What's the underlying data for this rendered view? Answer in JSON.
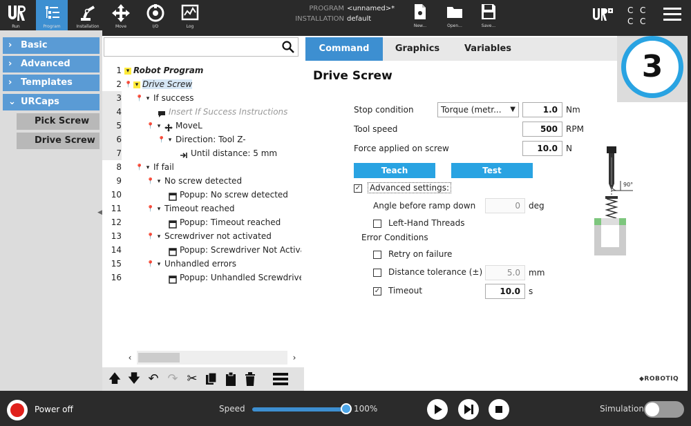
{
  "topbar": {
    "nav": [
      {
        "name": "run",
        "label": "Run"
      },
      {
        "name": "program",
        "label": "Program"
      },
      {
        "name": "installation",
        "label": "Installation"
      },
      {
        "name": "move",
        "label": "Move"
      },
      {
        "name": "io",
        "label": "I/O"
      },
      {
        "name": "log",
        "label": "Log"
      }
    ],
    "program_key": "PROGRAM",
    "program_value": "<unnamed>*",
    "installation_key": "INSTALLATION",
    "installation_value": "default",
    "file_buttons": [
      {
        "name": "new",
        "label": "New..."
      },
      {
        "name": "open",
        "label": "Open..."
      },
      {
        "name": "save",
        "label": "Save..."
      }
    ],
    "urplus_label": "UR+",
    "active_nav": "program"
  },
  "left_panel": {
    "categories": [
      {
        "label": "Basic",
        "chevron": "›"
      },
      {
        "label": "Advanced",
        "chevron": "›"
      },
      {
        "label": "Templates",
        "chevron": "›"
      },
      {
        "label": "URCaps",
        "chevron": "⌄"
      }
    ],
    "urcaps_items": [
      "Pick Screw",
      "Drive Screw"
    ]
  },
  "tree": {
    "rows": [
      {
        "num": "1",
        "text": "Robot Program"
      },
      {
        "num": "2",
        "text": "Drive Screw"
      },
      {
        "num": "3",
        "text": "If success"
      },
      {
        "num": "4",
        "text": "Insert If Success Instructions"
      },
      {
        "num": "5",
        "text": "MoveL"
      },
      {
        "num": "6",
        "text": "Direction: Tool Z-"
      },
      {
        "num": "7",
        "text": "Until distance: 5 mm"
      },
      {
        "num": "8",
        "text": "If fail"
      },
      {
        "num": "9",
        "text": "No screw detected"
      },
      {
        "num": "10",
        "text": "Popup: No screw detected"
      },
      {
        "num": "11",
        "text": "Timeout reached"
      },
      {
        "num": "12",
        "text": "Popup: Timeout reached"
      },
      {
        "num": "13",
        "text": "Screwdriver not activated"
      },
      {
        "num": "14",
        "text": "Popup: Screwdriver Not Activated"
      },
      {
        "num": "15",
        "text": "Unhandled errors"
      },
      {
        "num": "16",
        "text": "Popup: Unhandled Screwdriver Error"
      }
    ]
  },
  "tabs": [
    "Command",
    "Graphics",
    "Variables"
  ],
  "counter": "3",
  "command": {
    "title": "Drive Screw",
    "stop_condition_label": "Stop condition",
    "stop_condition_value": "Torque (metr...",
    "torque_value": "1.0",
    "torque_unit": "Nm",
    "tool_speed_label": "Tool speed",
    "tool_speed_value": "500",
    "tool_speed_unit": "RPM",
    "force_label": "Force applied on screw",
    "force_value": "10.0",
    "force_unit": "N",
    "teach_label": "Teach",
    "test_label": "Test",
    "advanced_label": "Advanced settings:",
    "advanced_checked": true,
    "angle_label": "Angle before ramp down",
    "angle_value": "0",
    "angle_unit": "deg",
    "left_hand_label": "Left-Hand Threads",
    "left_hand_checked": false,
    "error_conditions_label": "Error Conditions",
    "retry_label": "Retry on failure",
    "retry_checked": false,
    "distance_label": "Distance tolerance (±)",
    "distance_checked": false,
    "distance_value": "5.0",
    "distance_unit": "mm",
    "timeout_label": "Timeout",
    "timeout_checked": true,
    "timeout_value": "10.0",
    "timeout_unit": "s",
    "diagram_angle": "90°",
    "brand": "ROBOTIQ"
  },
  "footer": {
    "power_label": "Power off",
    "speed_label": "Speed",
    "speed_value": "100%",
    "speed_fraction": 1.0,
    "simulation_label": "Simulation",
    "simulation_on": false
  },
  "colors": {
    "accent_blue": "#3d8fd1",
    "category_blue": "#5a9bd5",
    "counter_ring": "#29a3e2",
    "power_red": "#e0201b",
    "highlight_yellow": "#ffeb3b"
  }
}
